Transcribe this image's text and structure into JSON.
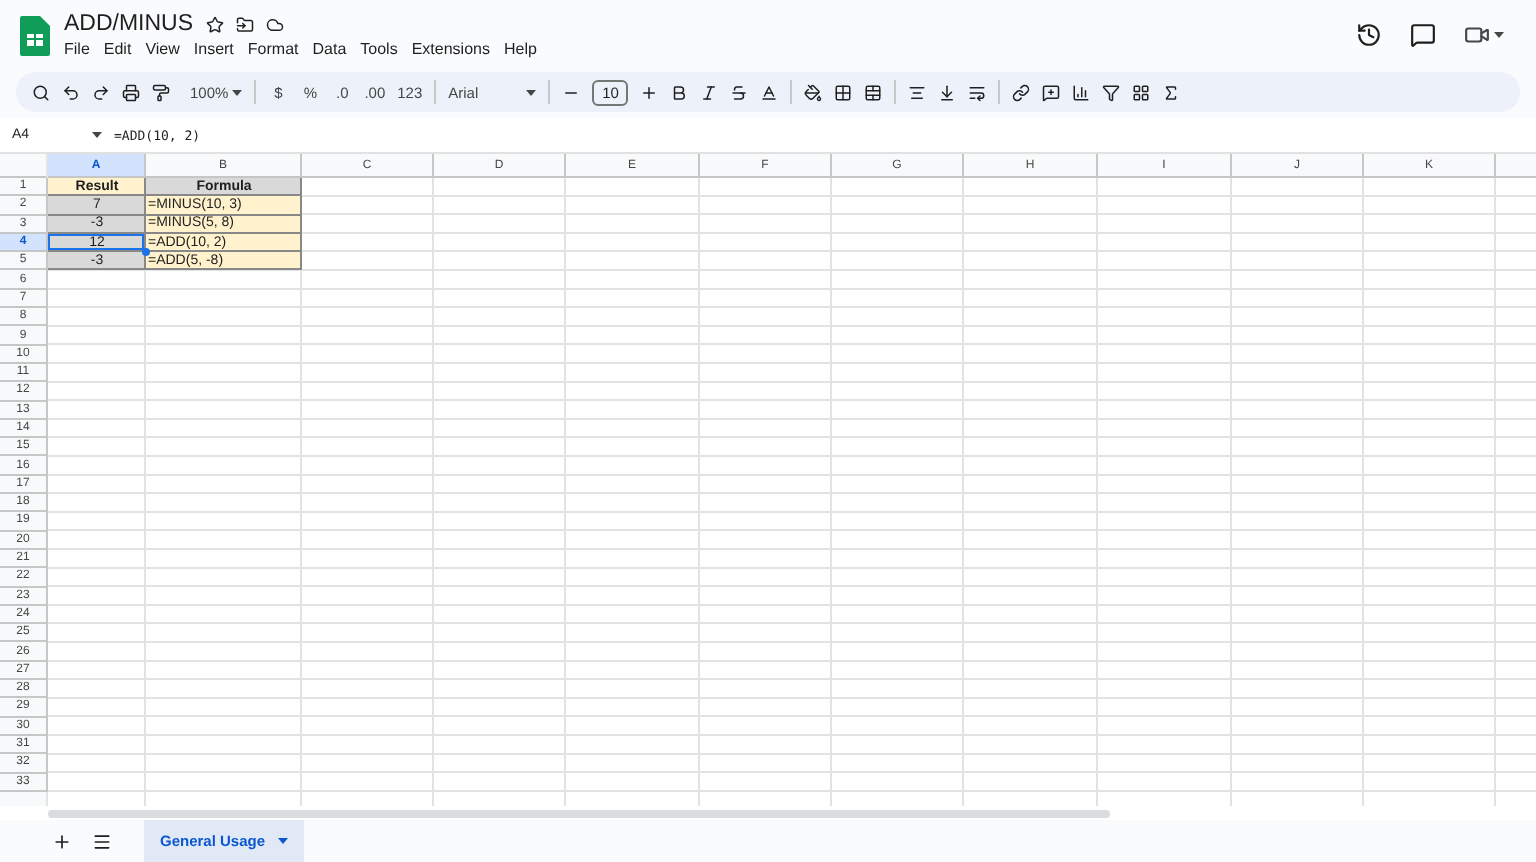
{
  "document": {
    "title": "ADD/MINUS"
  },
  "menu": [
    "File",
    "Edit",
    "View",
    "Insert",
    "Format",
    "Data",
    "Tools",
    "Extensions",
    "Help"
  ],
  "toolbar": {
    "zoom": "100%",
    "currency": "$",
    "percent": "%",
    "decrease_decimal": ".0",
    "increase_decimal": ".00",
    "number_format": "123",
    "font": "Arial",
    "font_size": "10"
  },
  "formula_bar": {
    "cell_ref": "A4",
    "formula": "=ADD(10, 2)"
  },
  "columns": [
    {
      "label": "A",
      "selected": true
    },
    {
      "label": "B",
      "selected": false
    },
    {
      "label": "C",
      "selected": false
    },
    {
      "label": "D",
      "selected": false
    },
    {
      "label": "E",
      "selected": false
    },
    {
      "label": "F",
      "selected": false
    },
    {
      "label": "G",
      "selected": false
    },
    {
      "label": "H",
      "selected": false
    },
    {
      "label": "I",
      "selected": false
    },
    {
      "label": "J",
      "selected": false
    },
    {
      "label": "K",
      "selected": false
    }
  ],
  "rows": [
    {
      "label": "1",
      "selected": false,
      "cells": [
        {
          "text": "Result",
          "kind": "header",
          "color": "#fff2cc",
          "selected": false
        },
        {
          "text": "Formula",
          "kind": "header",
          "color": "#d9d9d9",
          "selected": false
        }
      ]
    },
    {
      "label": "2",
      "selected": false,
      "cells": [
        {
          "text": "7",
          "kind": "value",
          "color": "#d9d9d9",
          "selected": false
        },
        {
          "text": "=MINUS(10, 3)",
          "kind": "value",
          "color": "#fff2cc",
          "selected": false
        }
      ]
    },
    {
      "label": "3",
      "selected": false,
      "cells": [
        {
          "text": "-3",
          "kind": "value",
          "color": "#d9d9d9",
          "selected": false
        },
        {
          "text": "=MINUS(5, 8)",
          "kind": "value",
          "color": "#fff2cc",
          "selected": false
        }
      ]
    },
    {
      "label": "4",
      "selected": true,
      "cells": [
        {
          "text": "12",
          "kind": "value",
          "color": "#d9d9d9",
          "selected": true
        },
        {
          "text": "=ADD(10, 2)",
          "kind": "value",
          "color": "#fff2cc",
          "selected": false
        }
      ]
    },
    {
      "label": "5",
      "selected": false,
      "cells": [
        {
          "text": "-3",
          "kind": "value",
          "color": "#d9d9d9",
          "selected": false
        },
        {
          "text": "=ADD(5, -8)",
          "kind": "value",
          "color": "#fff2cc",
          "selected": false
        }
      ]
    },
    {
      "label": "6",
      "selected": false
    },
    {
      "label": "7",
      "selected": false
    },
    {
      "label": "8",
      "selected": false
    },
    {
      "label": "9",
      "selected": false
    },
    {
      "label": "10",
      "selected": false
    },
    {
      "label": "11",
      "selected": false
    },
    {
      "label": "12",
      "selected": false
    },
    {
      "label": "13",
      "selected": false
    },
    {
      "label": "14",
      "selected": false
    },
    {
      "label": "15",
      "selected": false
    },
    {
      "label": "16",
      "selected": false
    },
    {
      "label": "17",
      "selected": false
    },
    {
      "label": "18",
      "selected": false
    },
    {
      "label": "19",
      "selected": false
    },
    {
      "label": "20",
      "selected": false
    },
    {
      "label": "21",
      "selected": false
    },
    {
      "label": "22",
      "selected": false
    },
    {
      "label": "23",
      "selected": false
    },
    {
      "label": "24",
      "selected": false
    },
    {
      "label": "25",
      "selected": false
    },
    {
      "label": "26",
      "selected": false
    },
    {
      "label": "27",
      "selected": false
    },
    {
      "label": "28",
      "selected": false
    },
    {
      "label": "29",
      "selected": false
    },
    {
      "label": "30",
      "selected": false
    },
    {
      "label": "31",
      "selected": false
    },
    {
      "label": "32",
      "selected": false
    },
    {
      "label": "33",
      "selected": false
    }
  ],
  "sheet_tabs": [
    {
      "label": "General Usage",
      "selected": true
    }
  ]
}
